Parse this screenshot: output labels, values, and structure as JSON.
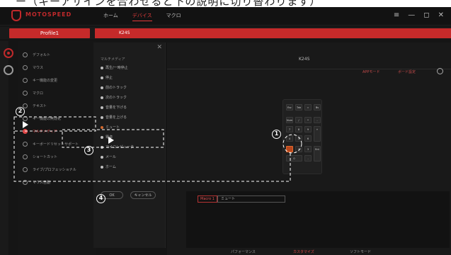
{
  "caption": "ー（キーアサインを合わせると下の説明に切り替わります）",
  "app": {
    "logo_text": "MOTOSPEED",
    "nav": [
      "ホーム",
      "デバイス",
      "マクロ"
    ],
    "active_nav": "デバイス",
    "window_controls": [
      "≡",
      "—",
      "◻",
      "✕"
    ]
  },
  "profile": {
    "label": "Profile1",
    "device_tab": "K24S"
  },
  "menu": {
    "items": [
      "デフォルト",
      "マウス",
      "キー機能の変更",
      "マクロ",
      "テキスト",
      "キー機能の無効化",
      "マルチメディア",
      "キーボードリセットサポート",
      "ショートカット",
      "ライブ/プロフェッショナル",
      "マウス自動"
    ],
    "active_index": 6
  },
  "macro_panel": {
    "close": "✕",
    "header": "マルチメディア",
    "items": [
      "再生/一時停止",
      "停止",
      "前のトラック",
      "次のトラック",
      "音量を下げる",
      "音量を上げる",
      "ミュート",
      "電卓",
      "マイコンピュータ",
      "メール",
      "ホーム"
    ],
    "selected_index": 6,
    "ok": "OK",
    "cancel": "キャンセル"
  },
  "main": {
    "model": "K24S",
    "link_a": "APPモード",
    "link_b": "ボード設定",
    "keys": [
      "Esc",
      "Tab",
      "=",
      "Bs",
      "Num",
      "/",
      "*",
      "-",
      "7",
      "8",
      "9",
      "+",
      "4",
      "5",
      "6",
      "1",
      "2",
      "3",
      "Ent",
      "0",
      "."
    ],
    "highlight_key_label": "",
    "binding": {
      "tag": "Macro 1",
      "value": "ミュート"
    },
    "modes": [
      "パフォーマンス",
      "カスタマイズ",
      "ソフトモード"
    ],
    "active_mode": 1
  },
  "annotations": [
    "1",
    "2",
    "3",
    "4"
  ]
}
